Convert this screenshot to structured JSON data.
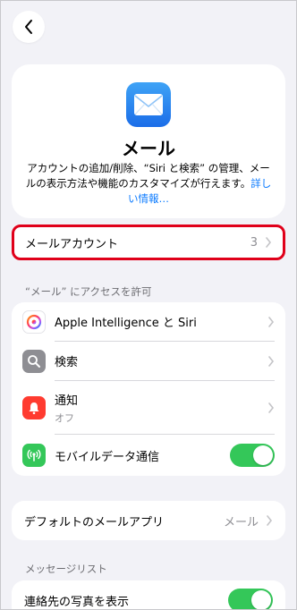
{
  "nav": {
    "back_icon": "chevron-left-icon"
  },
  "hero": {
    "app_icon": "mail-envelope-icon",
    "title": "メール",
    "description_line1": "アカウントの追加/削除、“Siri と検索” の管理、メー",
    "description_line2": "ルの表示方法や機能のカスタマイズが行えます。",
    "link_text_a": "詳し",
    "link_text_b": "い情報…"
  },
  "accounts_row": {
    "label": "メールアカウント",
    "value": "3"
  },
  "access_section": {
    "header": "“メール” にアクセスを許可",
    "items": [
      {
        "label": "Apple Intelligence と Siri",
        "icon": "apple-intelligence-icon"
      },
      {
        "label": "検索",
        "icon": "search-icon"
      },
      {
        "label": "通知",
        "sublabel": "オフ",
        "icon": "notification-bell-icon"
      },
      {
        "label": "モバイルデータ通信",
        "icon": "cellular-icon",
        "toggle": true
      }
    ]
  },
  "default_app_row": {
    "label": "デフォルトのメールアプリ",
    "value": "メール"
  },
  "message_list_section": {
    "header": "メッセージリスト",
    "items": [
      {
        "label": "連絡先の写真を表示",
        "toggle": true
      }
    ]
  },
  "colors": {
    "accent_link": "#0a7aff",
    "toggle_on": "#34c759",
    "highlight_border": "#e0001a",
    "background": "#f2f2f7"
  }
}
